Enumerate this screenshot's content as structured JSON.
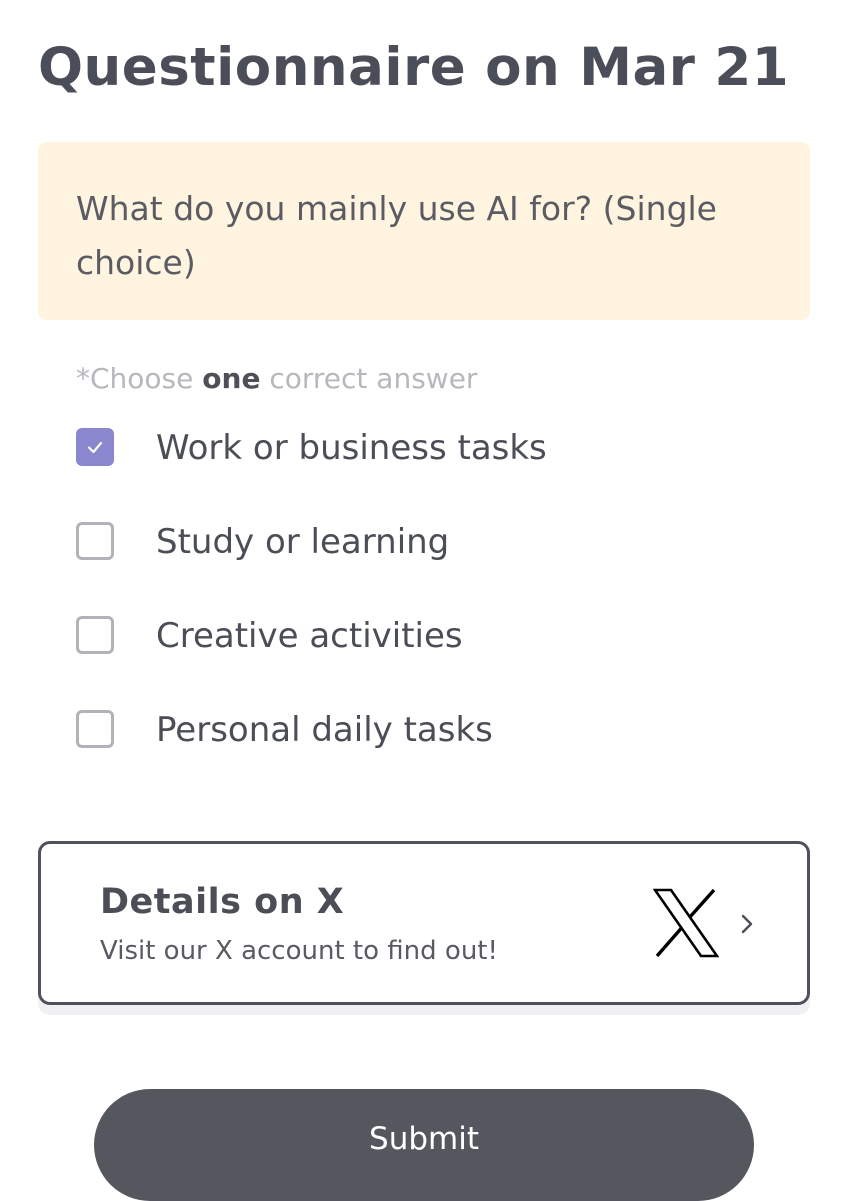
{
  "header": {
    "title": "Questionnaire on Mar 21"
  },
  "question": {
    "text": "What do you mainly use AI for? (Single choice)"
  },
  "instruction": {
    "prefix": "*Choose ",
    "emphasis": "one",
    "suffix": " correct answer"
  },
  "options": [
    {
      "label": "Work or business tasks",
      "checked": true
    },
    {
      "label": "Study or learning",
      "checked": false
    },
    {
      "label": "Creative activities",
      "checked": false
    },
    {
      "label": "Personal daily tasks",
      "checked": false
    }
  ],
  "details_card": {
    "title": "Details on X",
    "subtitle": "Visit our X account to find out!",
    "logo_icon": "x-logo-icon",
    "arrow_icon": "chevron-right-icon"
  },
  "submit": {
    "label": "Submit"
  },
  "colors": {
    "accent": "#8a87cf",
    "question_bg": "#fff4e0",
    "button_bg": "#55575f",
    "text": "#4b4d57",
    "muted": "#b7b8bd"
  }
}
